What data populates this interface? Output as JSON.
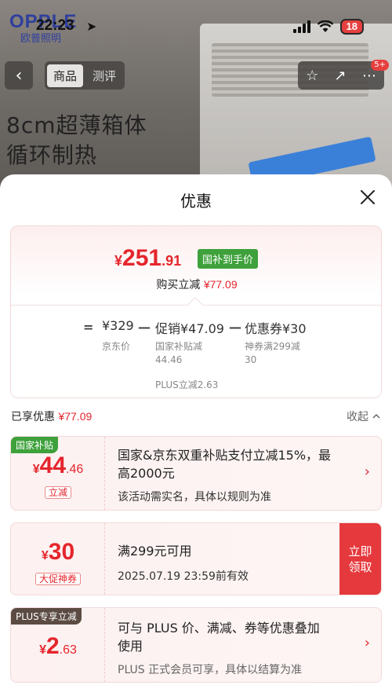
{
  "status_bar": {
    "time": "22:23",
    "battery": "18"
  },
  "background": {
    "brand": "OPPLE",
    "brand_sub": "欧普照明",
    "tabs": [
      "商品",
      "测评"
    ],
    "message_count": "5+",
    "hero_line1": "8cm超薄箱体",
    "hero_line2": "循环制热"
  },
  "sheet": {
    "title": "优惠",
    "final_price": {
      "currency": "¥",
      "integer": "251",
      "decimal": ".91"
    },
    "final_tag": "国补到手价",
    "buy_save_label": "购买立减",
    "buy_save_amount": "¥77.09",
    "formula": {
      "eq": "=",
      "minus": "—",
      "base": "¥329",
      "base_note": "京东价",
      "promo": "促销¥47.09",
      "promo_notes": [
        "国家补贴减",
        "44.46",
        "PLUS立减2.63"
      ],
      "coupon": "优惠券¥30",
      "coupon_notes": [
        "神券满299减",
        "30"
      ]
    },
    "enjoyed_label": "已享优惠",
    "enjoyed_amount": "¥77.09",
    "collapse_label": "收起",
    "coupons": [
      {
        "badge": "国家补贴",
        "currency": "¥",
        "integer": "44",
        "decimal": ".46",
        "type": "立减",
        "title_line1": "国家&京东双重补贴支付立减15%，最",
        "title_line2": "高2000元",
        "sub": "该活动需实名，具体以规则为准"
      },
      {
        "currency": "¥",
        "integer": "30",
        "type": "大促神券",
        "title": "满299元可用",
        "sub": "2025.07.19 23:59前有效",
        "claim_line1": "立即",
        "claim_line2": "领取"
      },
      {
        "badge": "PLUS专享立减",
        "currency": "¥",
        "integer": "2",
        "decimal": ".63",
        "title_line1": "可与 PLUS 价、满减、券等优惠叠加",
        "title_line2": "使用",
        "sub": "PLUS 正式会员可享，具体以结算为准"
      }
    ]
  },
  "colors": {
    "accent_red": "#e5252c",
    "subsidy_green": "#3ea13b",
    "plus_brown": "#5b4b42"
  }
}
